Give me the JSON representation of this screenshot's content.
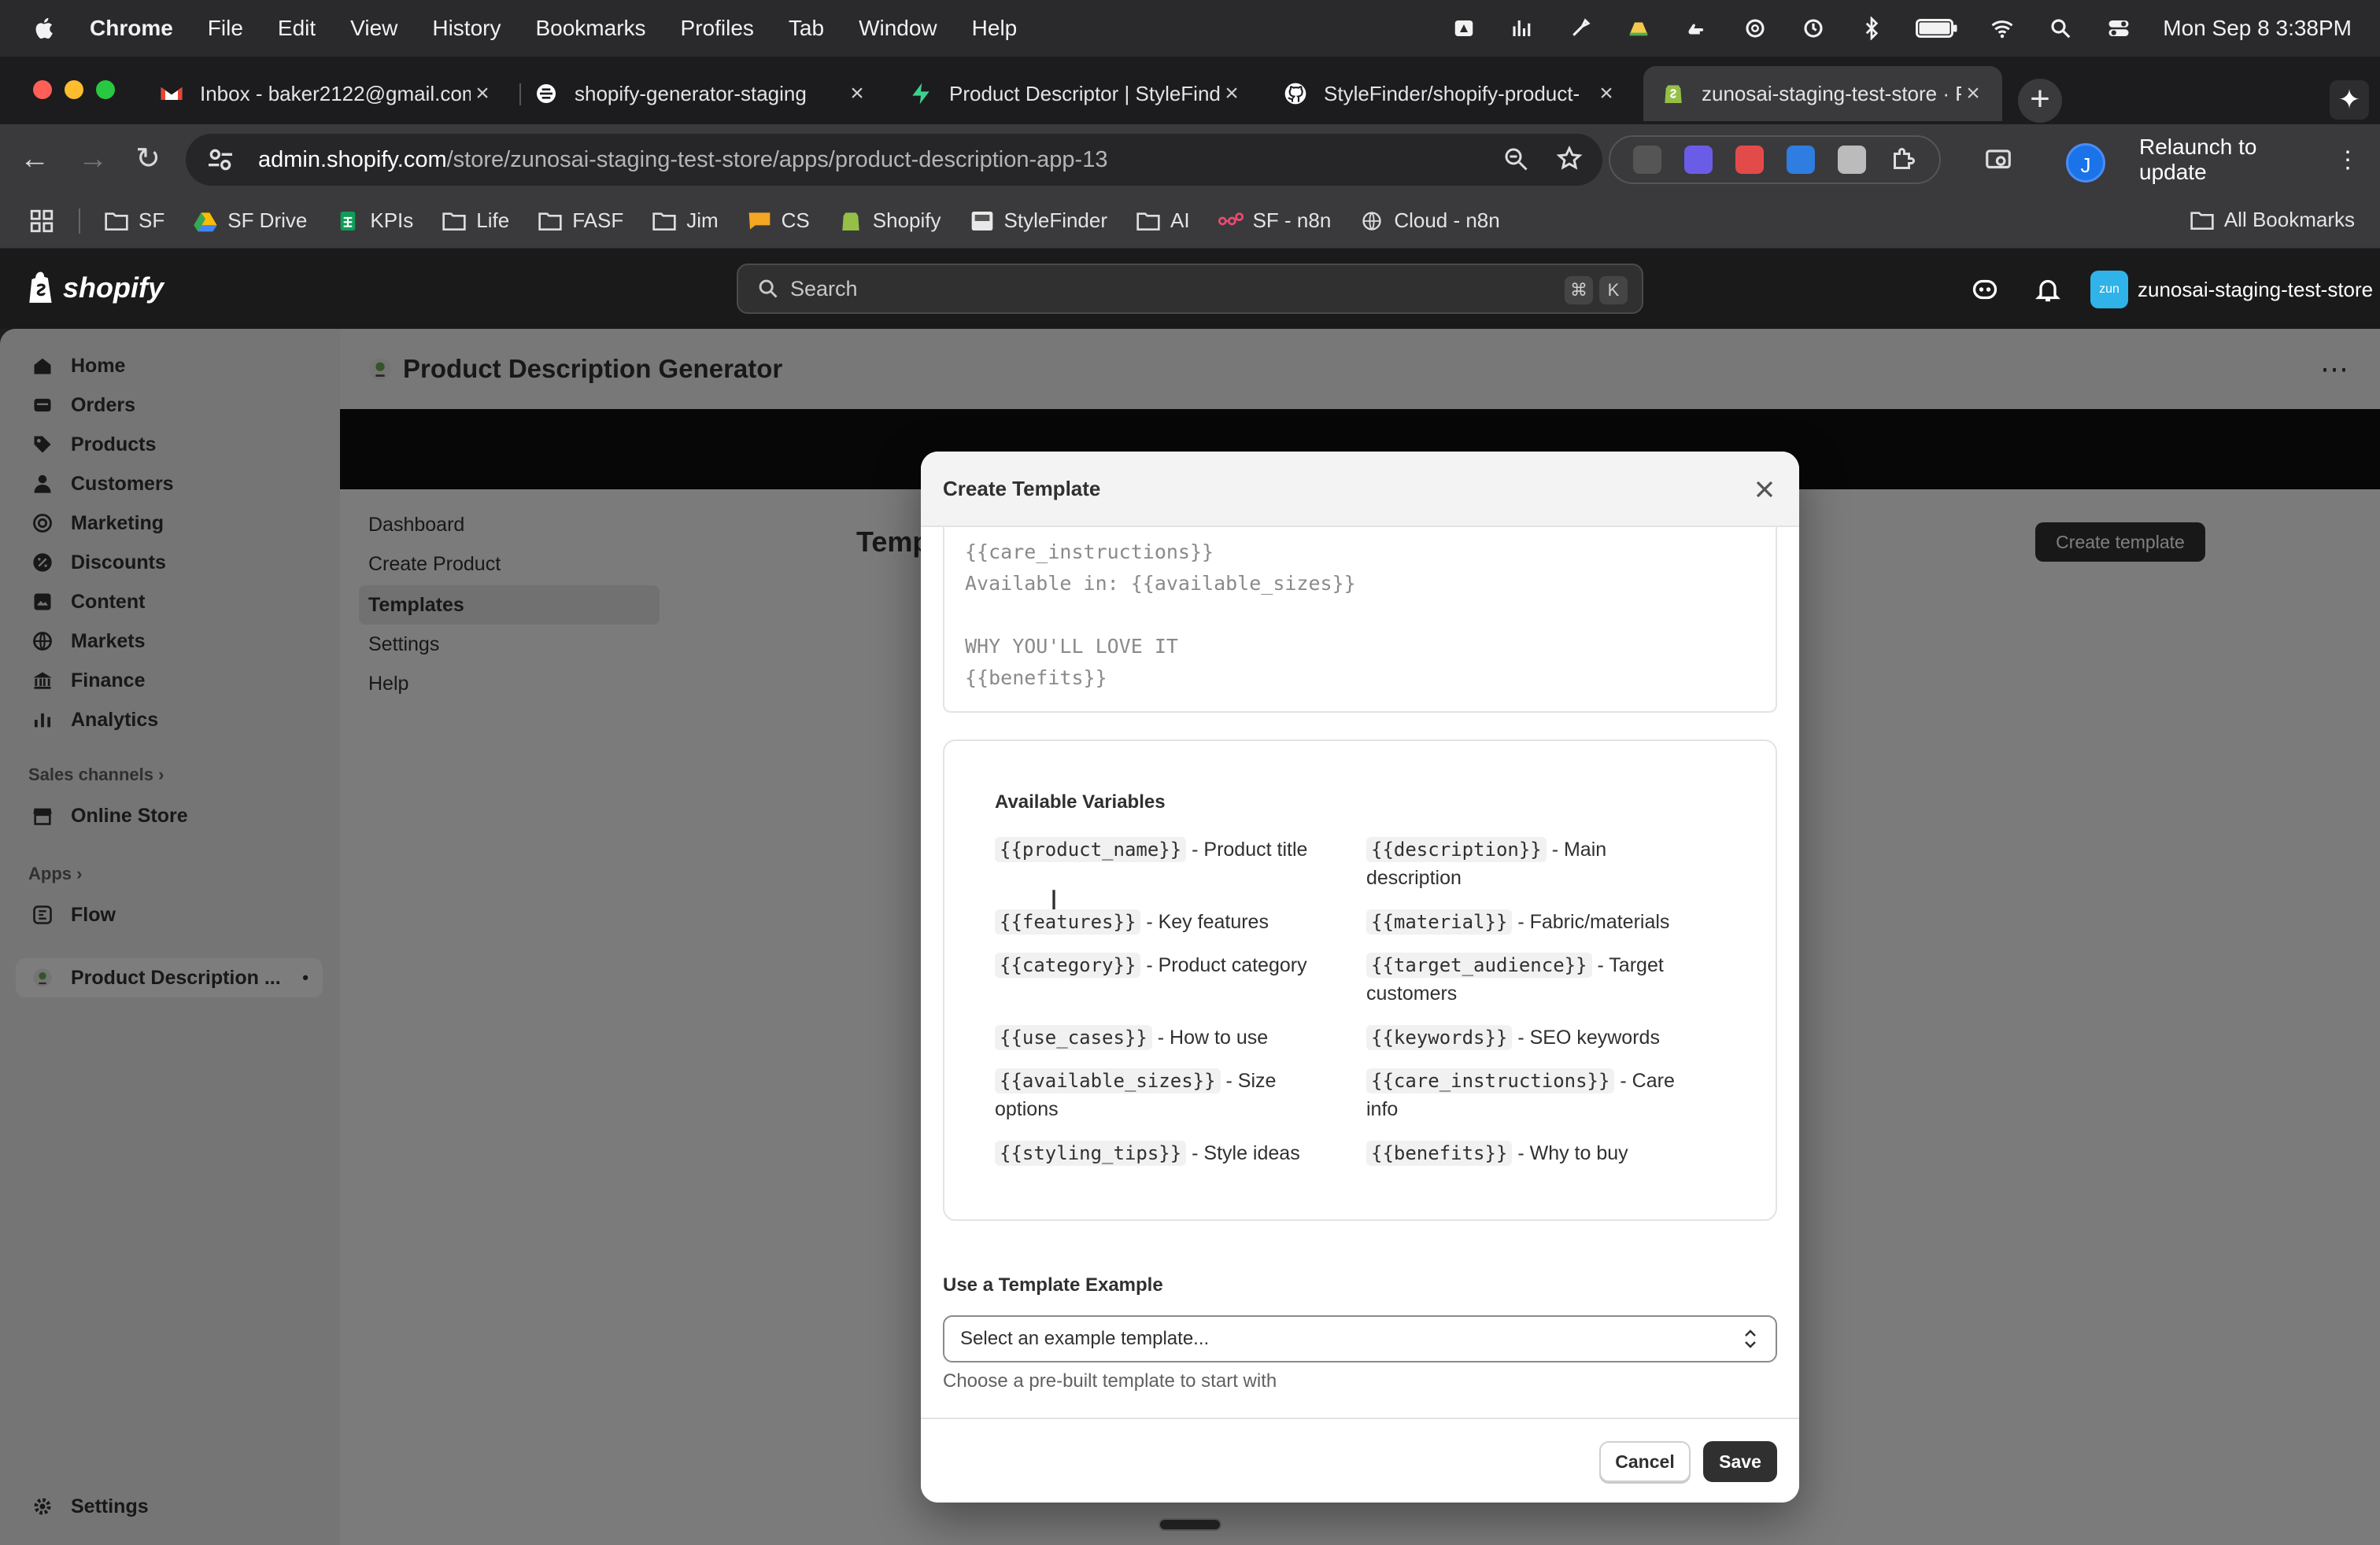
{
  "menubar": {
    "app": "Chrome",
    "items": [
      "File",
      "Edit",
      "View",
      "History",
      "Bookmarks",
      "Profiles",
      "Tab",
      "Window",
      "Help"
    ],
    "clock": "Mon Sep 8  3:38PM"
  },
  "tabs": [
    {
      "title": "Inbox - baker2122@gmail.com",
      "icon": "gmail-icon",
      "active": false
    },
    {
      "title": "shopify-generator-staging",
      "icon": "railway-icon",
      "active": false
    },
    {
      "title": "Product Descriptor | StyleFinder",
      "icon": "supabase-icon",
      "active": false
    },
    {
      "title": "StyleFinder/shopify-product-",
      "icon": "github-icon",
      "active": false
    },
    {
      "title": "zunosai-staging-test-store · Pr",
      "icon": "shopify-icon",
      "active": true
    }
  ],
  "toolbar": {
    "url_host": "admin.shopify.com",
    "url_path": "/store/zunosai-staging-test-store/apps/product-description-app-13",
    "profile_initial": "J",
    "relaunch_label": "Relaunch to update"
  },
  "bookmarks": {
    "items": [
      {
        "label": "SF",
        "icon": "folder-icon"
      },
      {
        "label": "SF Drive",
        "icon": "google-drive-icon"
      },
      {
        "label": "KPIs",
        "icon": "sheets-icon"
      },
      {
        "label": "Life",
        "icon": "folder-icon"
      },
      {
        "label": "FASF",
        "icon": "folder-icon"
      },
      {
        "label": "Jim",
        "icon": "folder-icon"
      },
      {
        "label": "CS",
        "icon": "chat-icon"
      },
      {
        "label": "Shopify",
        "icon": "shopify-icon"
      },
      {
        "label": "StyleFinder",
        "icon": "stylefinder-icon"
      },
      {
        "label": "AI",
        "icon": "folder-icon"
      },
      {
        "label": "SF - n8n",
        "icon": "n8n-icon"
      },
      {
        "label": "Cloud - n8n",
        "icon": "globe-icon"
      }
    ],
    "all_label": "All Bookmarks"
  },
  "shopify": {
    "brand": "shopify",
    "search_placeholder": "Search",
    "shortcut_cmd": "⌘",
    "shortcut_key": "K",
    "store_avatar": "zun",
    "store_name": "zunosai-staging-test-store"
  },
  "admin_nav": {
    "items": [
      {
        "label": "Home",
        "icon": "home-icon"
      },
      {
        "label": "Orders",
        "icon": "orders-icon"
      },
      {
        "label": "Products",
        "icon": "tag-icon"
      },
      {
        "label": "Customers",
        "icon": "person-icon"
      },
      {
        "label": "Marketing",
        "icon": "target-icon"
      },
      {
        "label": "Discounts",
        "icon": "discount-icon"
      },
      {
        "label": "Content",
        "icon": "content-icon"
      },
      {
        "label": "Markets",
        "icon": "globe-icon"
      },
      {
        "label": "Finance",
        "icon": "bank-icon"
      },
      {
        "label": "Analytics",
        "icon": "bar-chart-icon"
      }
    ],
    "sales_channels_label": "Sales channels",
    "online_store_label": "Online Store",
    "apps_label": "Apps",
    "flow_label": "Flow",
    "app_label": "Product Description ...",
    "settings_label": "Settings"
  },
  "app": {
    "title": "Product Description Generator",
    "nav": [
      "Dashboard",
      "Create Product",
      "Templates",
      "Settings",
      "Help"
    ],
    "active_nav": "Templates",
    "page_heading": "Temp",
    "create_button": "Create template"
  },
  "modal": {
    "title": "Create Template",
    "template_text_lines": [
      "{{care_instructions}}",
      "Available in: {{available_sizes}}",
      "",
      "WHY YOU'LL LOVE IT",
      "{{benefits}}"
    ],
    "variables_title": "Available Variables",
    "variables": [
      {
        "code": "{{product_name}}",
        "desc": " - Product title"
      },
      {
        "code": "{{description}}",
        "desc": " - Main description"
      },
      {
        "code": "{{features}}",
        "desc": " - Key features"
      },
      {
        "code": "{{material}}",
        "desc": " - Fabric/materials"
      },
      {
        "code": "{{category}}",
        "desc": " - Product category"
      },
      {
        "code": "{{target_audience}}",
        "desc": " - Target customers"
      },
      {
        "code": "{{use_cases}}",
        "desc": " - How to use"
      },
      {
        "code": "{{keywords}}",
        "desc": " - SEO keywords"
      },
      {
        "code": "{{available_sizes}}",
        "desc": " - Size options"
      },
      {
        "code": "{{care_instructions}}",
        "desc": " - Care info"
      },
      {
        "code": "{{styling_tips}}",
        "desc": " - Style ideas"
      },
      {
        "code": "{{benefits}}",
        "desc": " - Why to buy"
      }
    ],
    "example_label": "Use a Template Example",
    "example_select_value": "Select an example template...",
    "example_help": "Choose a pre-built template to start with",
    "cancel_label": "Cancel",
    "save_label": "Save"
  }
}
